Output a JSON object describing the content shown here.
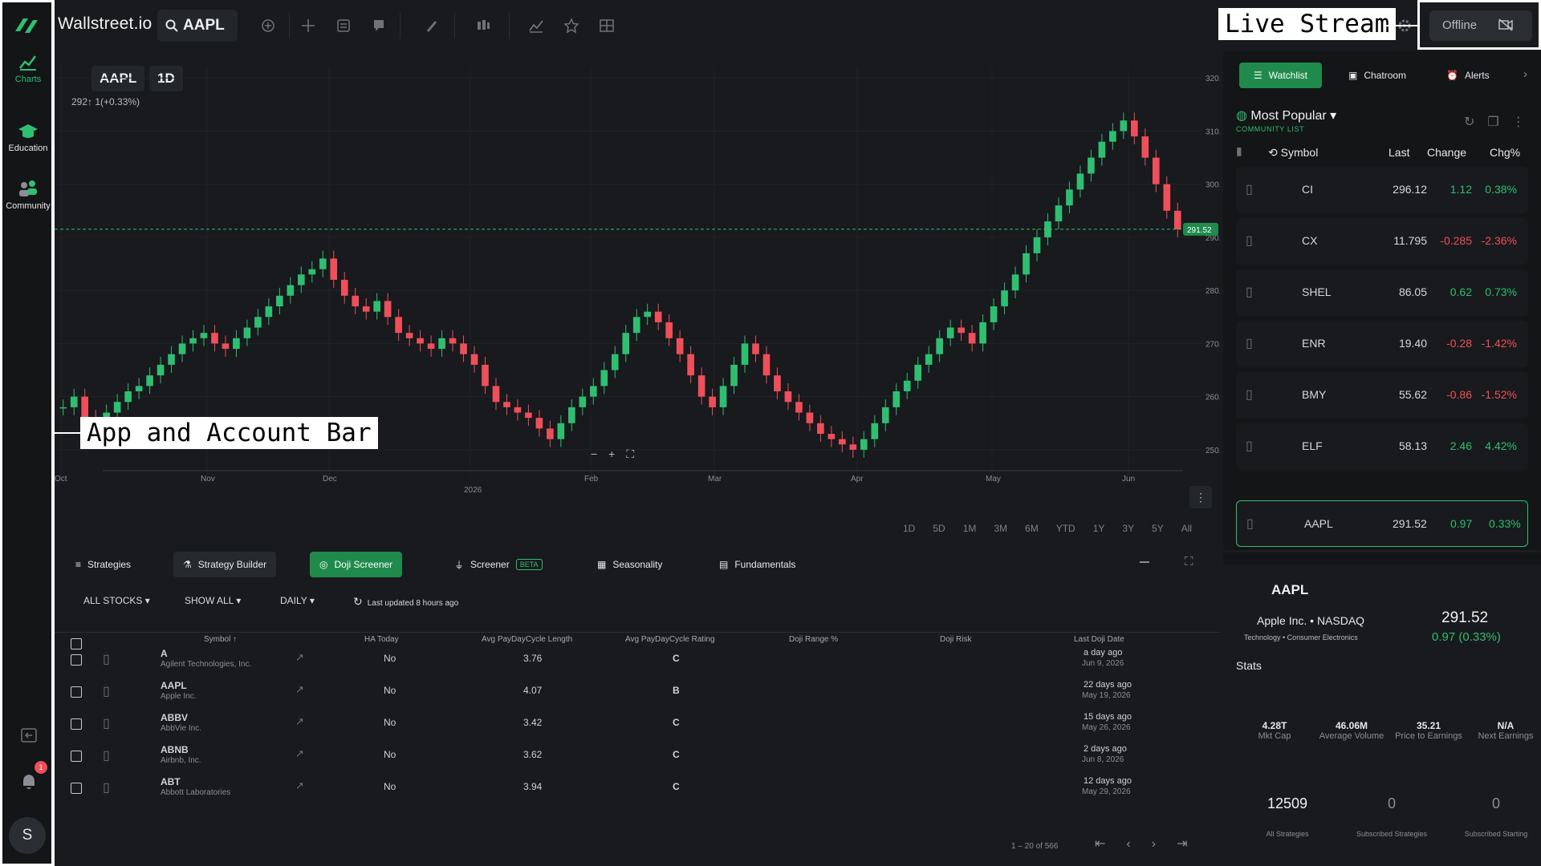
{
  "app": {
    "brand": "Wallstreet.io",
    "search_symbol": "AAPL"
  },
  "leftbar": {
    "items": [
      {
        "label": "Charts"
      },
      {
        "label": "Education"
      },
      {
        "label": "Community"
      }
    ],
    "notification_count": "1",
    "avatar_initial": "S"
  },
  "callouts": {
    "live_stream": "Live Stream",
    "app_bar": "App and Account Bar"
  },
  "topbar": {
    "offline_label": "Offline"
  },
  "chart": {
    "symbol": "AAPL",
    "interval": "1D",
    "change_text": "292↑ 1(+0.33%)",
    "price_tag": "291.52",
    "ranges": [
      "1D",
      "5D",
      "1M",
      "3M",
      "6M",
      "YTD",
      "1Y",
      "3Y",
      "5Y",
      "All"
    ]
  },
  "chart_data": {
    "type": "candlestick",
    "yticks": [
      "320.00",
      "310.00",
      "300.00",
      "290.00",
      "280.00",
      "270.00",
      "260.00",
      "250.00"
    ],
    "xticks": [
      "Oct",
      "Nov",
      "Dec",
      "2026",
      "Feb",
      "Mar",
      "Apr",
      "May",
      "Jun"
    ],
    "ylim": [
      245,
      322
    ],
    "last_price": 291.52,
    "close_series": [
      258,
      260,
      256,
      255,
      257,
      259,
      261,
      262,
      264,
      266,
      268,
      270,
      271,
      272,
      270,
      269,
      271,
      273,
      275,
      277,
      279,
      281,
      283,
      284,
      286,
      282,
      279,
      277,
      276,
      278,
      275,
      272,
      271,
      270,
      269,
      271,
      270,
      268,
      266,
      262,
      259,
      258,
      257,
      256,
      254,
      252,
      255,
      258,
      260,
      262,
      265,
      268,
      272,
      275,
      276,
      274,
      271,
      268,
      264,
      260,
      258,
      262,
      266,
      270,
      268,
      264,
      261,
      259,
      257,
      255,
      253,
      252,
      251,
      250,
      252,
      255,
      258,
      261,
      263,
      266,
      268,
      271,
      273,
      272,
      270,
      274,
      277,
      280,
      283,
      287,
      290,
      293,
      296,
      299,
      302,
      305,
      308,
      310,
      312,
      309,
      305,
      300,
      295,
      291.52
    ]
  },
  "bottom": {
    "tabs": [
      {
        "label": "Strategies"
      },
      {
        "label": "Strategy Builder"
      },
      {
        "label": "Doji Screener"
      },
      {
        "label": "Screener",
        "badge": "BETA"
      },
      {
        "label": "Seasonality"
      },
      {
        "label": "Fundamentals"
      }
    ],
    "filters": {
      "stocks": "ALL STOCKS",
      "show": "SHOW ALL",
      "period": "DAILY",
      "updated": "Last updated 8 hours ago"
    },
    "columns": [
      "Symbol",
      "HA Today",
      "Avg PayDayCycle Length",
      "Avg PayDayCycle Rating",
      "Doji Range %",
      "Doji Risk",
      "Last Doji Date"
    ],
    "rows": [
      {
        "symbol": "A",
        "name": "Agilent Technologies, Inc.",
        "ha": "No",
        "len": "3.76",
        "rating": "C",
        "ago": "a day ago",
        "date": "Jun 9, 2026"
      },
      {
        "symbol": "AAPL",
        "name": "Apple Inc.",
        "ha": "No",
        "len": "4.07",
        "rating": "B",
        "ago": "22 days ago",
        "date": "May 19, 2026"
      },
      {
        "symbol": "ABBV",
        "name": "AbbVie Inc.",
        "ha": "No",
        "len": "3.42",
        "rating": "C",
        "ago": "15 days ago",
        "date": "May 26, 2026"
      },
      {
        "symbol": "ABNB",
        "name": "Airbnb, Inc.",
        "ha": "No",
        "len": "3.62",
        "rating": "C",
        "ago": "2 days ago",
        "date": "Jun 8, 2026"
      },
      {
        "symbol": "ABT",
        "name": "Abbott Laboratories",
        "ha": "No",
        "len": "3.94",
        "rating": "C",
        "ago": "12 days ago",
        "date": "May 29, 2026"
      }
    ],
    "pagination": "1 – 20 of 566"
  },
  "right": {
    "tabs": [
      {
        "label": "Watchlist"
      },
      {
        "label": "Chatroom"
      },
      {
        "label": "Alerts"
      }
    ],
    "list_title": "Most Popular",
    "list_sub": "COMMUNITY LIST",
    "columns": [
      "Symbol",
      "Last",
      "Change",
      "Chg%"
    ],
    "watchlist": [
      {
        "sym": "CI",
        "last": "296.12",
        "chg": "1.12",
        "pct": "0.38%",
        "dir": "pos"
      },
      {
        "sym": "CX",
        "last": "11.795",
        "chg": "-0.285",
        "pct": "-2.36%",
        "dir": "neg"
      },
      {
        "sym": "SHEL",
        "last": "86.05",
        "chg": "0.62",
        "pct": "0.73%",
        "dir": "pos"
      },
      {
        "sym": "ENR",
        "last": "19.40",
        "chg": "-0.28",
        "pct": "-1.42%",
        "dir": "neg"
      },
      {
        "sym": "BMY",
        "last": "55.62",
        "chg": "-0.86",
        "pct": "-1.52%",
        "dir": "neg"
      },
      {
        "sym": "ELF",
        "last": "58.13",
        "chg": "2.46",
        "pct": "4.42%",
        "dir": "pos"
      }
    ],
    "selected": {
      "sym": "AAPL",
      "last": "291.52",
      "chg": "0.97",
      "pct": "0.33%"
    },
    "detail": {
      "symbol": "AAPL",
      "company": "Apple Inc. • NASDAQ",
      "price": "291.52",
      "sector": "Technology • Consumer Electronics",
      "change": "0.97 (0.33%)",
      "stats_title": "Stats",
      "stats": [
        {
          "v": "4.28T",
          "l": "Mkt Cap"
        },
        {
          "v": "46.06M",
          "l": "Average Volume"
        },
        {
          "v": "35.21",
          "l": "Price to Earnings"
        },
        {
          "v": "N/A",
          "l": "Next Earnings"
        }
      ],
      "counts": [
        {
          "v": "12509",
          "l": "All Strategies"
        },
        {
          "v": "0",
          "l": "Subscribed Strategies"
        },
        {
          "v": "0",
          "l": "Subscribed Starting"
        }
      ]
    }
  },
  "colors": {
    "up": "#2fbf71",
    "down": "#ef4f5a",
    "accent": "#1f8a4c"
  }
}
